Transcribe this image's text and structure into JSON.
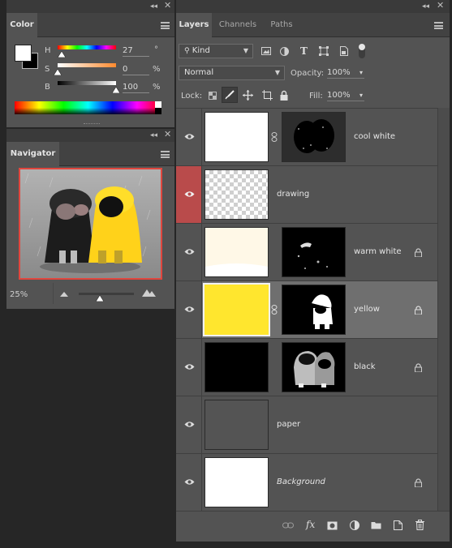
{
  "color_panel": {
    "tab": "Color",
    "h_label": "H",
    "h_value": "27",
    "h_unit": "°",
    "s_label": "S",
    "s_value": "0",
    "s_unit": "%",
    "b_label": "B",
    "b_value": "100",
    "b_unit": "%",
    "h_level": 0.075,
    "s_level": 0.0,
    "b_level": 1.0
  },
  "navigator_panel": {
    "tab": "Navigator",
    "zoom": "25%",
    "zoom_slider_level": 0.38
  },
  "layers_panel": {
    "tabs": [
      "Layers",
      "Channels",
      "Paths"
    ],
    "filter_label": "Kind",
    "blend_mode": "Normal",
    "opacity_label": "Opacity:",
    "opacity_value": "100%",
    "lock_label": "Lock:",
    "fill_label": "Fill:",
    "fill_value": "100%",
    "layers": [
      {
        "name": "cool white",
        "thumb": "#ffffff",
        "has_mask": true,
        "locked": false,
        "selected": false,
        "red_eye": false
      },
      {
        "name": "drawing",
        "thumb": "transparent",
        "has_mask": false,
        "locked": false,
        "selected": false,
        "red_eye": true
      },
      {
        "name": "warm white",
        "thumb": "#fff8e7",
        "has_mask": true,
        "locked": true,
        "selected": false,
        "red_eye": false
      },
      {
        "name": "yellow",
        "thumb": "#ffe62e",
        "has_mask": true,
        "locked": true,
        "selected": true,
        "red_eye": false
      },
      {
        "name": "black",
        "thumb": "#000000",
        "has_mask": true,
        "locked": true,
        "selected": false,
        "red_eye": false
      },
      {
        "name": "paper",
        "thumb": "#545454",
        "has_mask": false,
        "locked": false,
        "selected": false,
        "red_eye": false
      },
      {
        "name": "Background",
        "thumb": "#ffffff",
        "has_mask": false,
        "locked": true,
        "selected": false,
        "red_eye": false
      }
    ],
    "footer_icons": [
      "link-icon",
      "fx-icon",
      "mask-icon",
      "adjustment-icon",
      "folder-icon",
      "new-layer-icon",
      "trash-icon"
    ],
    "fx_label": "fx"
  }
}
